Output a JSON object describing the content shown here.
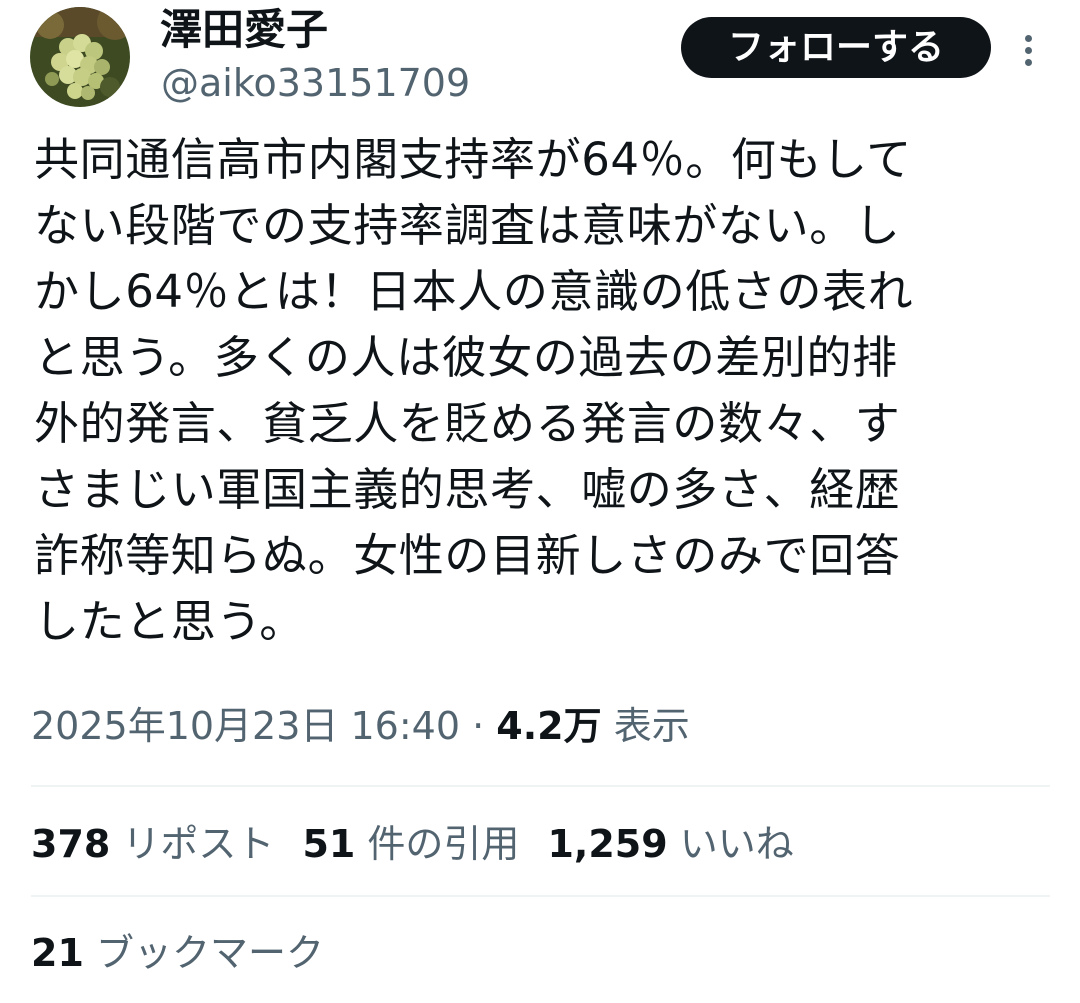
{
  "author": {
    "display_name": "澤田愛子",
    "handle": "@aiko33151709",
    "avatar_icon": "grape-photo-avatar"
  },
  "follow_label": "フォローする",
  "more_icon": "vertical-dots-icon",
  "tweet": {
    "lines": [
      "共同通信高市内閣支持率が64％。何もして",
      "ない段階での支持率調査は意味がない。し",
      "かし64％とは！日本人の意識の低さの表れ",
      "と思う。多くの人は彼女の過去の差別的排",
      "外的発言、貧乏人を貶める発言の数々、す",
      "さまじい軍国主義的思考、嘘の多さ、経歴",
      "詐称等知らぬ。女性の目新しさのみで回答",
      "したと思う。"
    ],
    "datetime": "2025年10月23日 16:40",
    "separator": "·",
    "views_count": "4.2万",
    "views_label": "表示"
  },
  "stats": {
    "reposts_count": "378",
    "reposts_label": "リポスト",
    "quotes_count": "51",
    "quotes_label": "件の引用",
    "likes_count": "1,259",
    "likes_label": "いいね",
    "bookmarks_count": "21",
    "bookmarks_label": "ブックマーク"
  },
  "colors": {
    "text_primary": "#0f1419",
    "text_secondary": "#536471",
    "divider": "#eff3f4",
    "follow_button_bg": "#0f1419"
  }
}
